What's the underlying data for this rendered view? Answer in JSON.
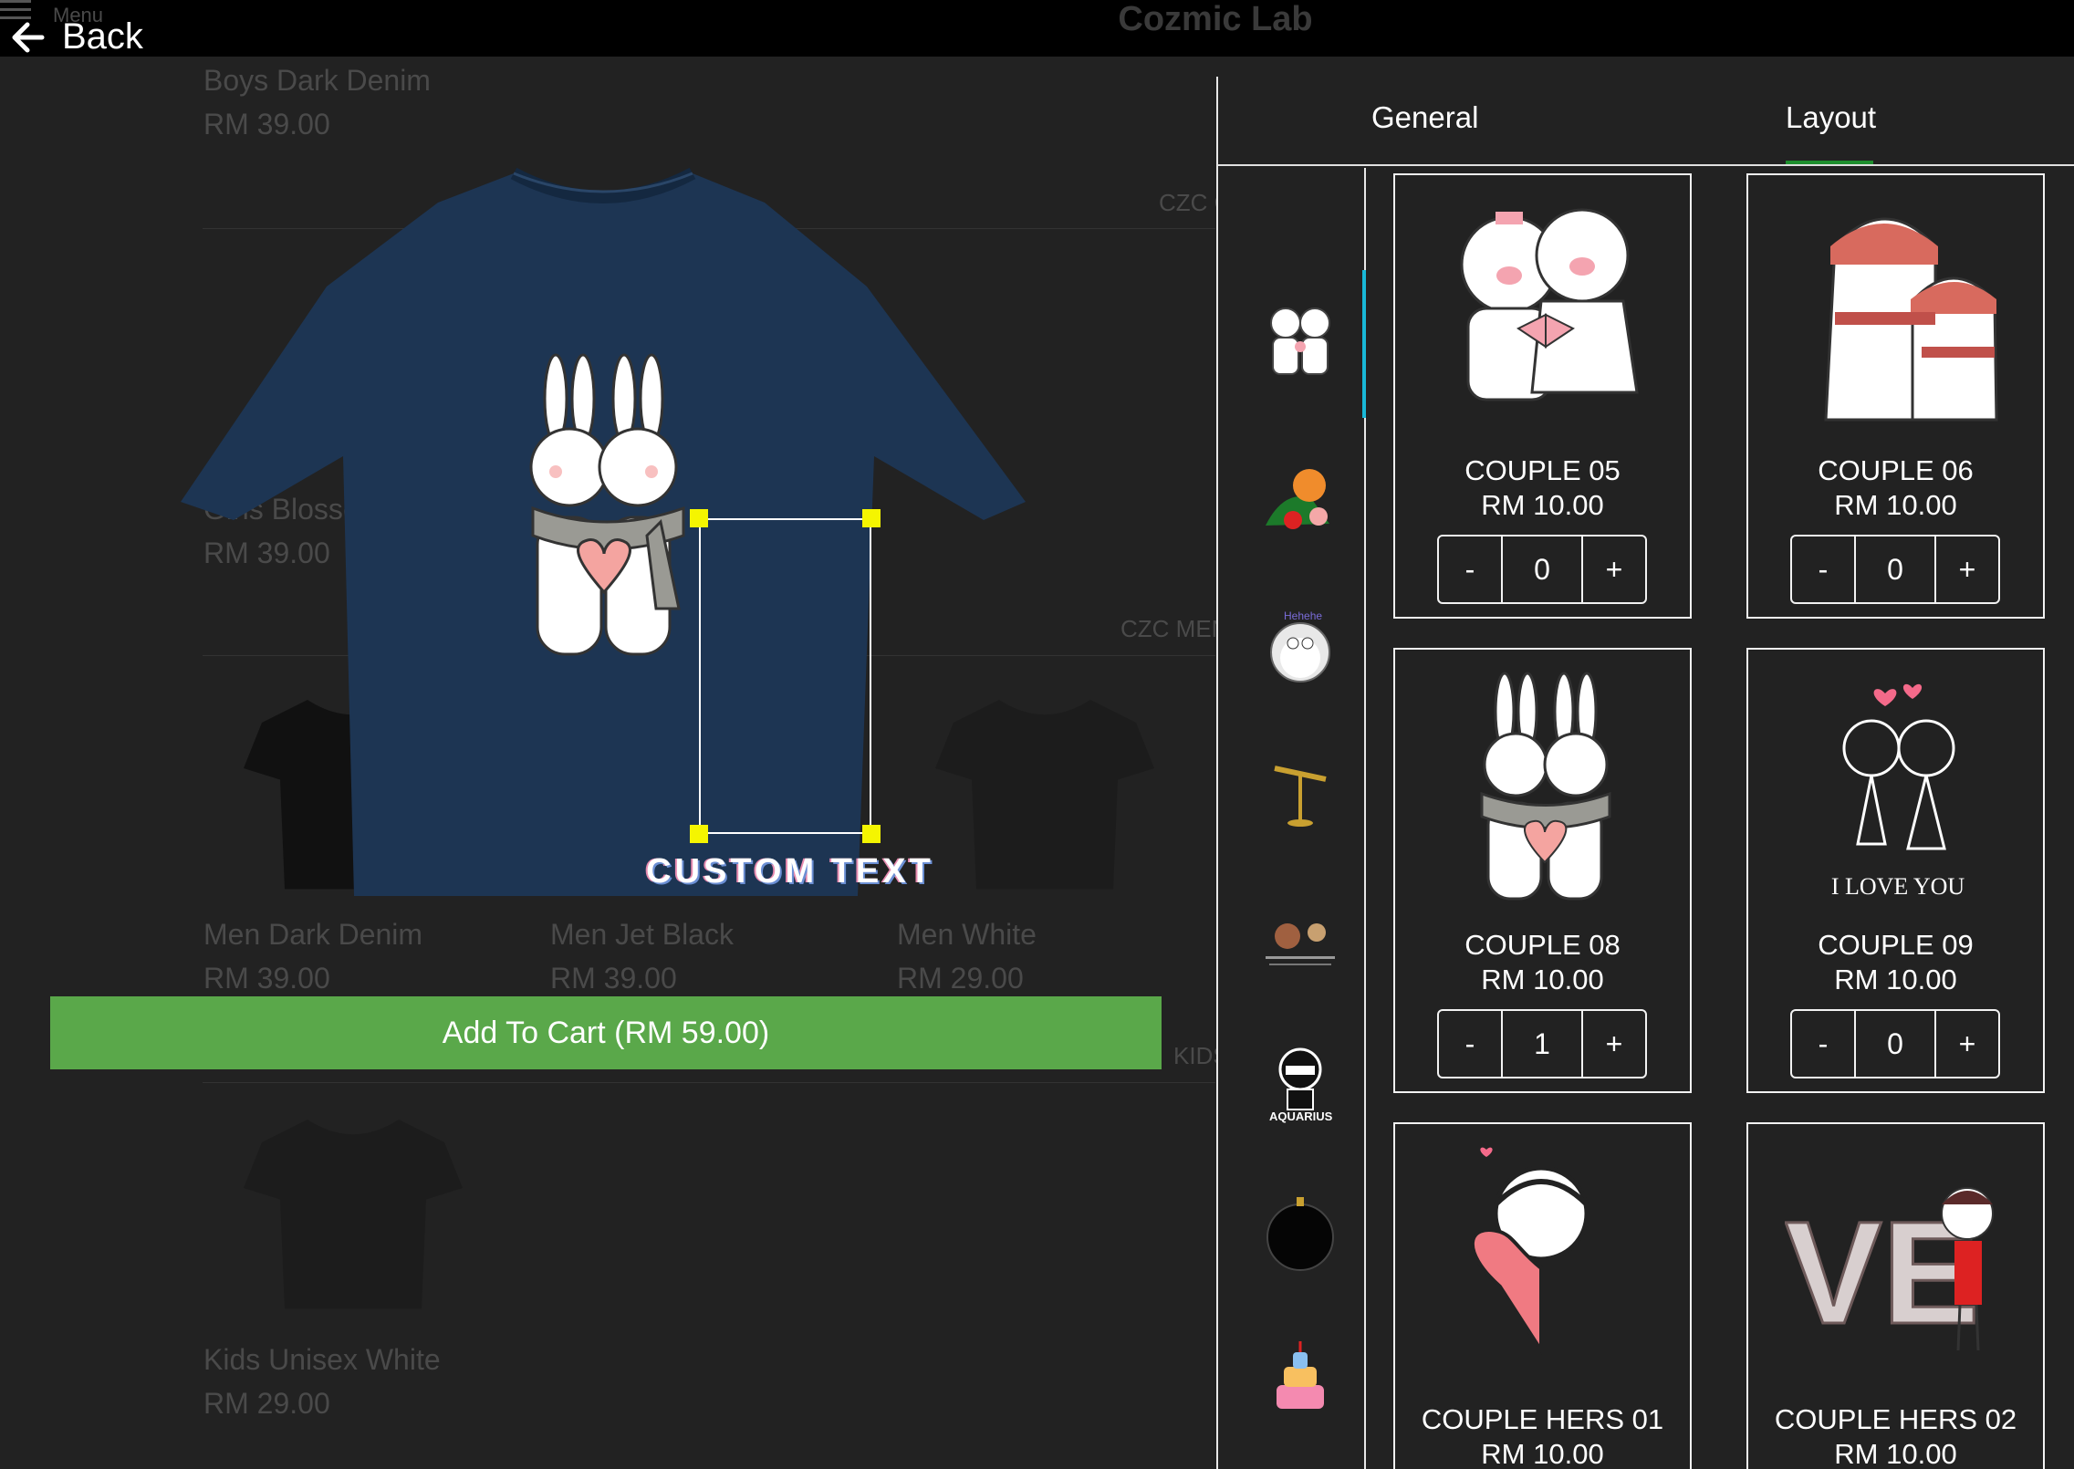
{
  "header": {
    "menu_label": "Menu",
    "app_title": "Cozmic Lab",
    "back_label": "Back"
  },
  "catalog": {
    "items": [
      {
        "name": "Boys Dark Denim",
        "price": "RM 39.00"
      },
      {
        "name": "Girls Blossom",
        "price": "RM 39.00"
      },
      {
        "name": "Men Dark Denim",
        "price": "RM 39.00"
      },
      {
        "name": "Men Jet Black",
        "price": "RM 39.00"
      },
      {
        "name": "Men White",
        "price": "RM 29.00"
      },
      {
        "name": "Kids Unisex White",
        "price": "RM 29.00"
      }
    ]
  },
  "preview": {
    "custom_text": "CUSTOM TEXT",
    "shirt_color": "#1d3553"
  },
  "cart": {
    "add_label": "Add To Cart (RM 59.00)"
  },
  "panel": {
    "tabs": [
      {
        "label": "General"
      },
      {
        "label": "Layout"
      }
    ],
    "active_tab": "Layout",
    "sections": [
      {
        "label": "CZC GIRLS"
      },
      {
        "label": "CZC MEN/UNISEX"
      },
      {
        "label": "KIDS UNISEX"
      }
    ],
    "categories": [
      {
        "icon": "couple-pigs-icon"
      },
      {
        "icon": "lion-dance-icon"
      },
      {
        "icon": "doraemon-icon"
      },
      {
        "icon": "gold-stand-icon"
      },
      {
        "icon": "infographic-icon"
      },
      {
        "icon": "aquarius-ninja-icon"
      },
      {
        "icon": "black-ornament-icon"
      },
      {
        "icon": "birthday-cake-icon"
      }
    ],
    "designs": [
      {
        "name": "COUPLE 05",
        "price": "RM 10.00",
        "qty": "0",
        "minus": "-",
        "plus": "+"
      },
      {
        "name": "COUPLE 06",
        "price": "RM 10.00",
        "qty": "0",
        "minus": "-",
        "plus": "+"
      },
      {
        "name": "COUPLE 08",
        "price": "RM 10.00",
        "qty": "1",
        "minus": "-",
        "plus": "+"
      },
      {
        "name": "COUPLE 09",
        "price": "RM 10.00",
        "qty": "0",
        "minus": "-",
        "plus": "+",
        "art_text": "I LOVE YOU"
      },
      {
        "name": "COUPLE HERS 01",
        "price": "RM 10.00"
      },
      {
        "name": "COUPLE HERS 02",
        "price": "RM 10.00",
        "art_text": "VE"
      }
    ]
  },
  "colors": {
    "accent_green": "#5aa84a",
    "tab_underline": "#1e8f2e",
    "scroll_indicator": "#19b8d8",
    "handle_yellow": "#f5f500"
  }
}
